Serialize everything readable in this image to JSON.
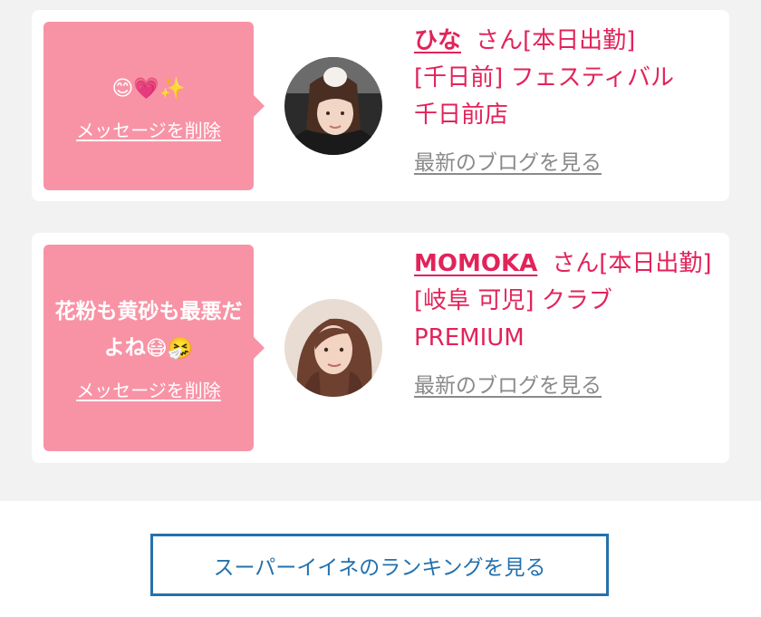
{
  "cards": [
    {
      "message_text": "",
      "message_emoji": [
        "😊",
        "💗",
        "✨"
      ],
      "delete_label": "メッセージを削除",
      "name": "ひな",
      "suffix": "さん[本日出勤]",
      "shop_line1": "[千日前] フェスティバル",
      "shop_line2": "千日前店",
      "blog_label": "最新のブログを見る",
      "avatar_icon": "girl-photo-avatar"
    },
    {
      "message_text": "花粉も黄砂も最悪だよね",
      "message_emoji": [
        "😷",
        "🤧"
      ],
      "delete_label": "メッセージを削除",
      "name": "MOMOKA",
      "suffix": "さん[本日出勤]",
      "shop_line1": "[岐阜 可児] クラブ",
      "shop_line2": "PREMIUM",
      "blog_label": "最新のブログを見る",
      "avatar_icon": "girl-photo-avatar"
    }
  ],
  "ranking_button_label": "スーパーイイネのランキングを見る",
  "colors": {
    "bubble": "#f893a6",
    "accent": "#e2235a",
    "link_gray": "#8a8a8a",
    "button_blue": "#2471ad",
    "background_gray": "#f2f2f2"
  }
}
